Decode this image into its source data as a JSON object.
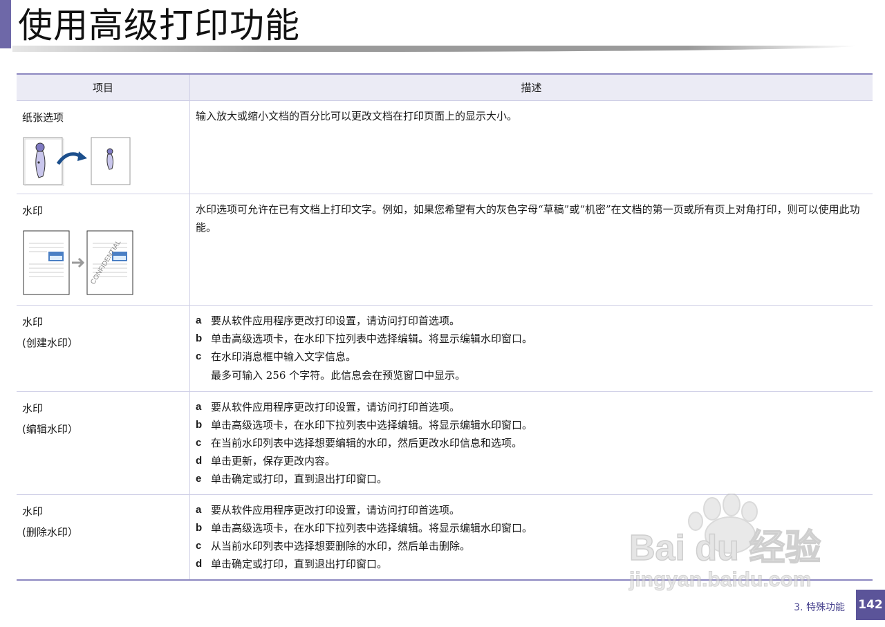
{
  "page": {
    "title": "使用高级打印功能",
    "section": "3.  特殊功能",
    "page_number": "142",
    "accent_color": "#6e68a8"
  },
  "table": {
    "headers": [
      "项目",
      "描述"
    ],
    "rows": [
      {
        "item": "纸张选项",
        "description": "输入放大或缩小文档的百分比可以更改文档在打印页面上的显示大小。"
      },
      {
        "item": "水印",
        "description": "水印选项可允许在已有文档上打印文字。例如，如果您希望有大的灰色字母“草稿”或“机密”在文档的第一页或所有页上对角打印，则可以使用此功能。",
        "illustration_text": "CONFIDENTIAL"
      },
      {
        "item": "水印",
        "item_sub": "(创建水印）",
        "steps": [
          {
            "letter": "a",
            "text": "要从软件应用程序更改打印设置，请访问打印首选项。"
          },
          {
            "letter": "b",
            "text": "单击高级选项卡，在水印下拉列表中选择编辑。将显示编辑水印窗口。"
          },
          {
            "letter": "c",
            "text": "在水印消息框中输入文字信息。"
          }
        ],
        "note": "最多可输入 256 个字符。此信息会在预览窗口中显示。"
      },
      {
        "item": "水印",
        "item_sub": "(编辑水印）",
        "steps": [
          {
            "letter": "a",
            "text": "要从软件应用程序更改打印设置，请访问打印首选项。"
          },
          {
            "letter": "b",
            "text": "单击高级选项卡，在水印下拉列表中选择编辑。将显示编辑水印窗口。"
          },
          {
            "letter": "c",
            "text": "在当前水印列表中选择想要编辑的水印，然后更改水印信息和选项。"
          },
          {
            "letter": "d",
            "text": "单击更新，保存更改内容。"
          },
          {
            "letter": "e",
            "text": "单击确定或打印，直到退出打印窗口。"
          }
        ]
      },
      {
        "item": "水印",
        "item_sub": "(删除水印）",
        "steps": [
          {
            "letter": "a",
            "text": "要从软件应用程序更改打印设置，请访问打印首选项。"
          },
          {
            "letter": "b",
            "text": "单击高级选项卡，在水印下拉列表中选择编辑。将显示编辑水印窗口。"
          },
          {
            "letter": "c",
            "text": "从当前水印列表中选择想要删除的水印，然后单击删除。"
          },
          {
            "letter": "d",
            "text": "单击确定或打印，直到退出打印窗口。"
          }
        ]
      }
    ]
  },
  "watermark": {
    "line1": "Bai du 经验",
    "line2": "jingyan.baidu.com"
  }
}
